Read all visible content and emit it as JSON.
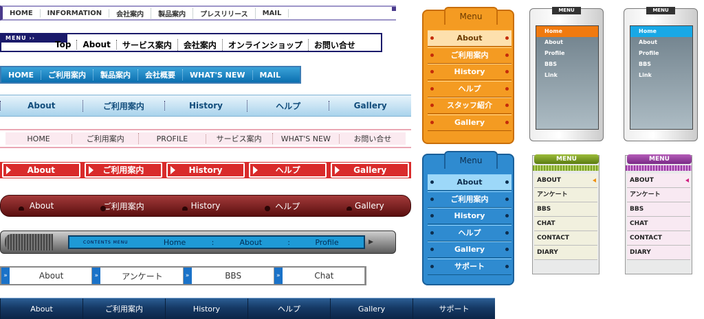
{
  "bar1": [
    "HOME",
    "INFORMATION",
    "会社案内",
    "製品案内",
    "プレスリリース",
    "MAIL"
  ],
  "bar2": {
    "tag": "MENU ››",
    "items": [
      "Top",
      "About",
      "サービス案内",
      "会社案内",
      "オンラインショップ",
      "お問い合せ"
    ]
  },
  "bar3": [
    "HOME",
    "ご利用案内",
    "製品案内",
    "会社概要",
    "WHAT'S NEW",
    "MAIL"
  ],
  "bar4": [
    "About",
    "ご利用案内",
    "History",
    "ヘルプ",
    "Gallery"
  ],
  "bar5": [
    "HOME",
    "ご利用案内",
    "PROFILE",
    "サービス案内",
    "WHAT'S NEW",
    "お問い合せ"
  ],
  "bar6": [
    "About",
    "ご利用案内",
    "History",
    "ヘルプ",
    "Gallery"
  ],
  "bar7": [
    "About",
    "ご利用案内",
    "History",
    "ヘルプ",
    "Gallery"
  ],
  "bar8": {
    "label": "CONTENTS MENU",
    "items": [
      "Home",
      "About",
      "Profile"
    ],
    "sep": ":"
  },
  "bar9": [
    "About",
    "アンケート",
    "BBS",
    "Chat"
  ],
  "bar10": [
    "About",
    "ご利用案内",
    "History",
    "ヘルプ",
    "Gallery",
    "サポート"
  ],
  "tab_orange": {
    "title": "Menu",
    "items": [
      "About",
      "ご利用案内",
      "History",
      "ヘルプ",
      "スタッフ紹介",
      "Gallery"
    ]
  },
  "tab_blue": {
    "title": "Menu",
    "items": [
      "About",
      "ご利用案内",
      "History",
      "ヘルプ",
      "Gallery",
      "サポート"
    ]
  },
  "device1": {
    "tag": "MENU",
    "items": [
      "Home",
      "About",
      "Profile",
      "BBS",
      "Link"
    ]
  },
  "device2": {
    "tag": "MENU",
    "items": [
      "Home",
      "About",
      "Profile",
      "BBS",
      "Link"
    ]
  },
  "scroll1": {
    "title": "MENU",
    "items": [
      "ABOUT",
      "アンケート",
      "BBS",
      "CHAT",
      "CONTACT",
      "DIARY"
    ]
  },
  "scroll2": {
    "title": "MENU",
    "items": [
      "ABOUT",
      "アンケート",
      "BBS",
      "CHAT",
      "CONTACT",
      "DIARY"
    ]
  }
}
